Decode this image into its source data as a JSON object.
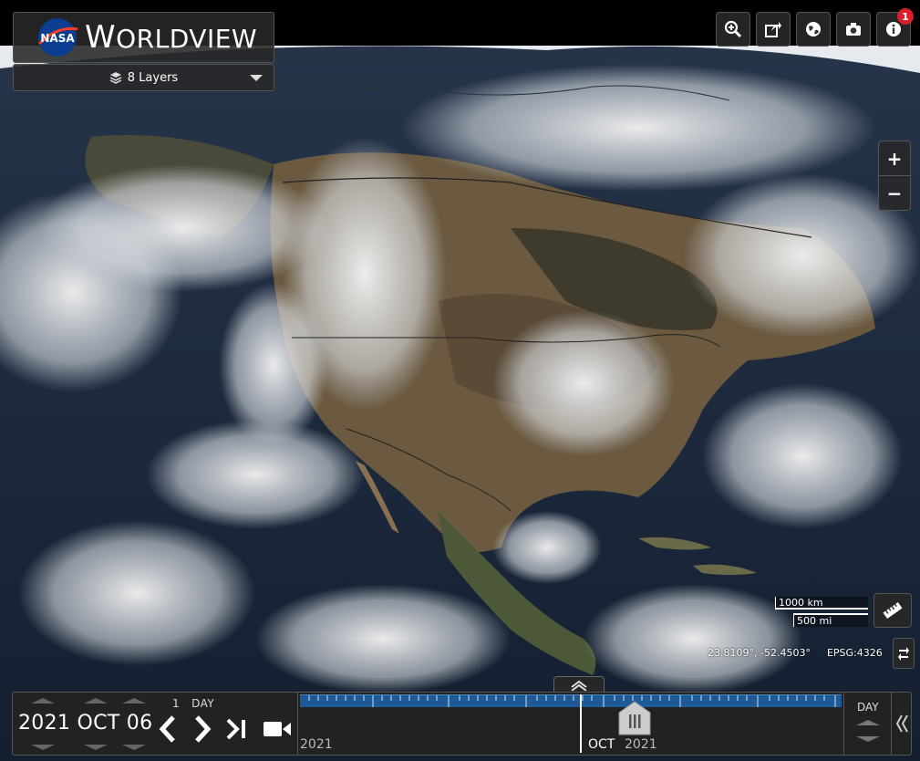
{
  "app": {
    "logo_text": "NASA",
    "title_first_letter": "W",
    "title_rest": "ORLDVIEW"
  },
  "layers_button": {
    "label": "8 Layers"
  },
  "toolbar": {
    "buttons": [
      {
        "icon": "zoom-search-icon"
      },
      {
        "icon": "share-icon"
      },
      {
        "icon": "projection-globe-icon"
      },
      {
        "icon": "camera-icon"
      },
      {
        "icon": "info-icon",
        "badge": "1"
      }
    ]
  },
  "zoom": {
    "in_label": "+",
    "out_label": "−"
  },
  "scale": {
    "km_label": "1000 km",
    "mi_label": "500 mi"
  },
  "coordinates": {
    "latlon": "23.8109°, -52.4503°",
    "projection": "EPSG:4326"
  },
  "timebar": {
    "date": "2021 OCT 06",
    "interval_amount": "1",
    "interval_unit": "DAY",
    "zoom_level": "DAY",
    "timeline_year_left": "2021",
    "timeline_month": "OCT",
    "timeline_year": "2021"
  },
  "colors": {
    "badge": "#d8202a",
    "timeline_blue": "#1e5a96"
  }
}
